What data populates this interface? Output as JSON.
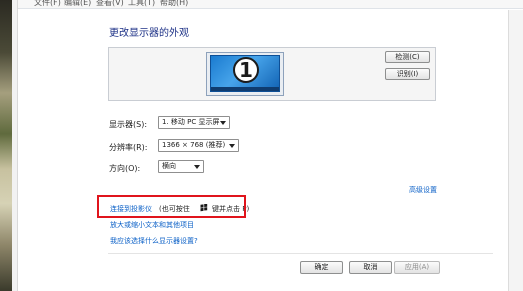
{
  "menu": {
    "items": [
      "文件(F)",
      "编辑(E)",
      "查看(V)",
      "工具(T)",
      "帮助(H)"
    ]
  },
  "page": {
    "title": "更改显示器的外观"
  },
  "preview": {
    "monitor_number": "1",
    "detect_button": "检测(C)",
    "identify_button": "识别(I)"
  },
  "settings": {
    "display_label": "显示器(S):",
    "display_value": "1. 移动 PC 显示屏",
    "resolution_label": "分辨率(R):",
    "resolution_value": "1366 × 768 (推荐)",
    "orientation_label": "方向(O):",
    "orientation_value": "横向"
  },
  "links": {
    "advanced": "高级设置",
    "projector": "连接到投影仪",
    "projector_hint_prefix": "(也可按住",
    "projector_hint_suffix": "键并点击 P)",
    "text_size": "放大或缩小文本和其他项目",
    "help": "我应该选择什么显示器设置?"
  },
  "footer": {
    "ok": "确定",
    "cancel": "取消",
    "apply": "应用(A)"
  },
  "colors": {
    "link": "#0b60c7",
    "title": "#1e3287",
    "highlight": "#e0141c"
  },
  "icons": {
    "windows_key": "windows-logo-icon"
  }
}
